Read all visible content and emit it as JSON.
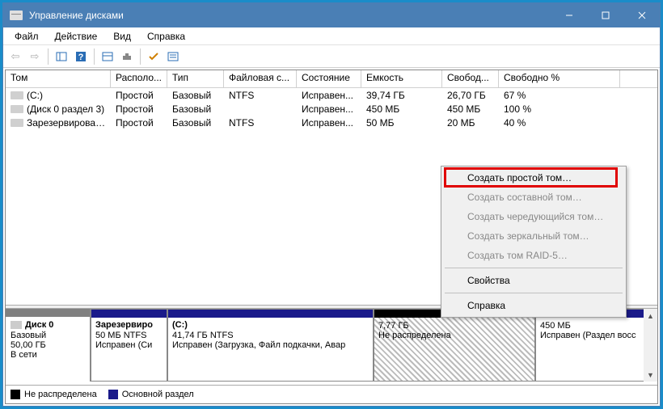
{
  "window": {
    "title": "Управление дисками"
  },
  "menu": {
    "file": "Файл",
    "action": "Действие",
    "view": "Вид",
    "help": "Справка"
  },
  "columns": [
    "Том",
    "Располо...",
    "Тип",
    "Файловая с...",
    "Состояние",
    "Емкость",
    "Свобод...",
    "Свободно %"
  ],
  "volumes": [
    {
      "name": "(C:)",
      "layout": "Простой",
      "type": "Базовый",
      "fs": "NTFS",
      "status": "Исправен...",
      "capacity": "39,74 ГБ",
      "free": "26,70 ГБ",
      "pct": "67 %"
    },
    {
      "name": "(Диск 0 раздел 3)",
      "layout": "Простой",
      "type": "Базовый",
      "fs": "",
      "status": "Исправен...",
      "capacity": "450 МБ",
      "free": "450 МБ",
      "pct": "100 %"
    },
    {
      "name": "Зарезервировано...",
      "layout": "Простой",
      "type": "Базовый",
      "fs": "NTFS",
      "status": "Исправен...",
      "capacity": "50 МБ",
      "free": "20 МБ",
      "pct": "40 %"
    }
  ],
  "disk": {
    "name": "Диск 0",
    "type": "Базовый",
    "size": "50,00 ГБ",
    "status": "В сети",
    "parts": [
      {
        "title": "Зарезервиро",
        "line1": "50 МБ NTFS",
        "line2": "Исправен (Си"
      },
      {
        "title": "(C:)",
        "line1": "41,74 ГБ NTFS",
        "line2": "Исправен (Загрузка, Файл подкачки, Авар"
      },
      {
        "title": "",
        "line1": "7,77 ГБ",
        "line2": "Не распределена"
      },
      {
        "title": "",
        "line1": "450 МБ",
        "line2": "Исправен (Раздел восс"
      }
    ]
  },
  "legend": {
    "unalloc": "Не распределена",
    "primary": "Основной раздел"
  },
  "context": {
    "simple": "Создать простой том…",
    "spanned": "Создать составной том…",
    "striped": "Создать чередующийся том…",
    "mirrored": "Создать зеркальный том…",
    "raid5": "Создать том RAID-5…",
    "properties": "Свойства",
    "help": "Справка"
  }
}
